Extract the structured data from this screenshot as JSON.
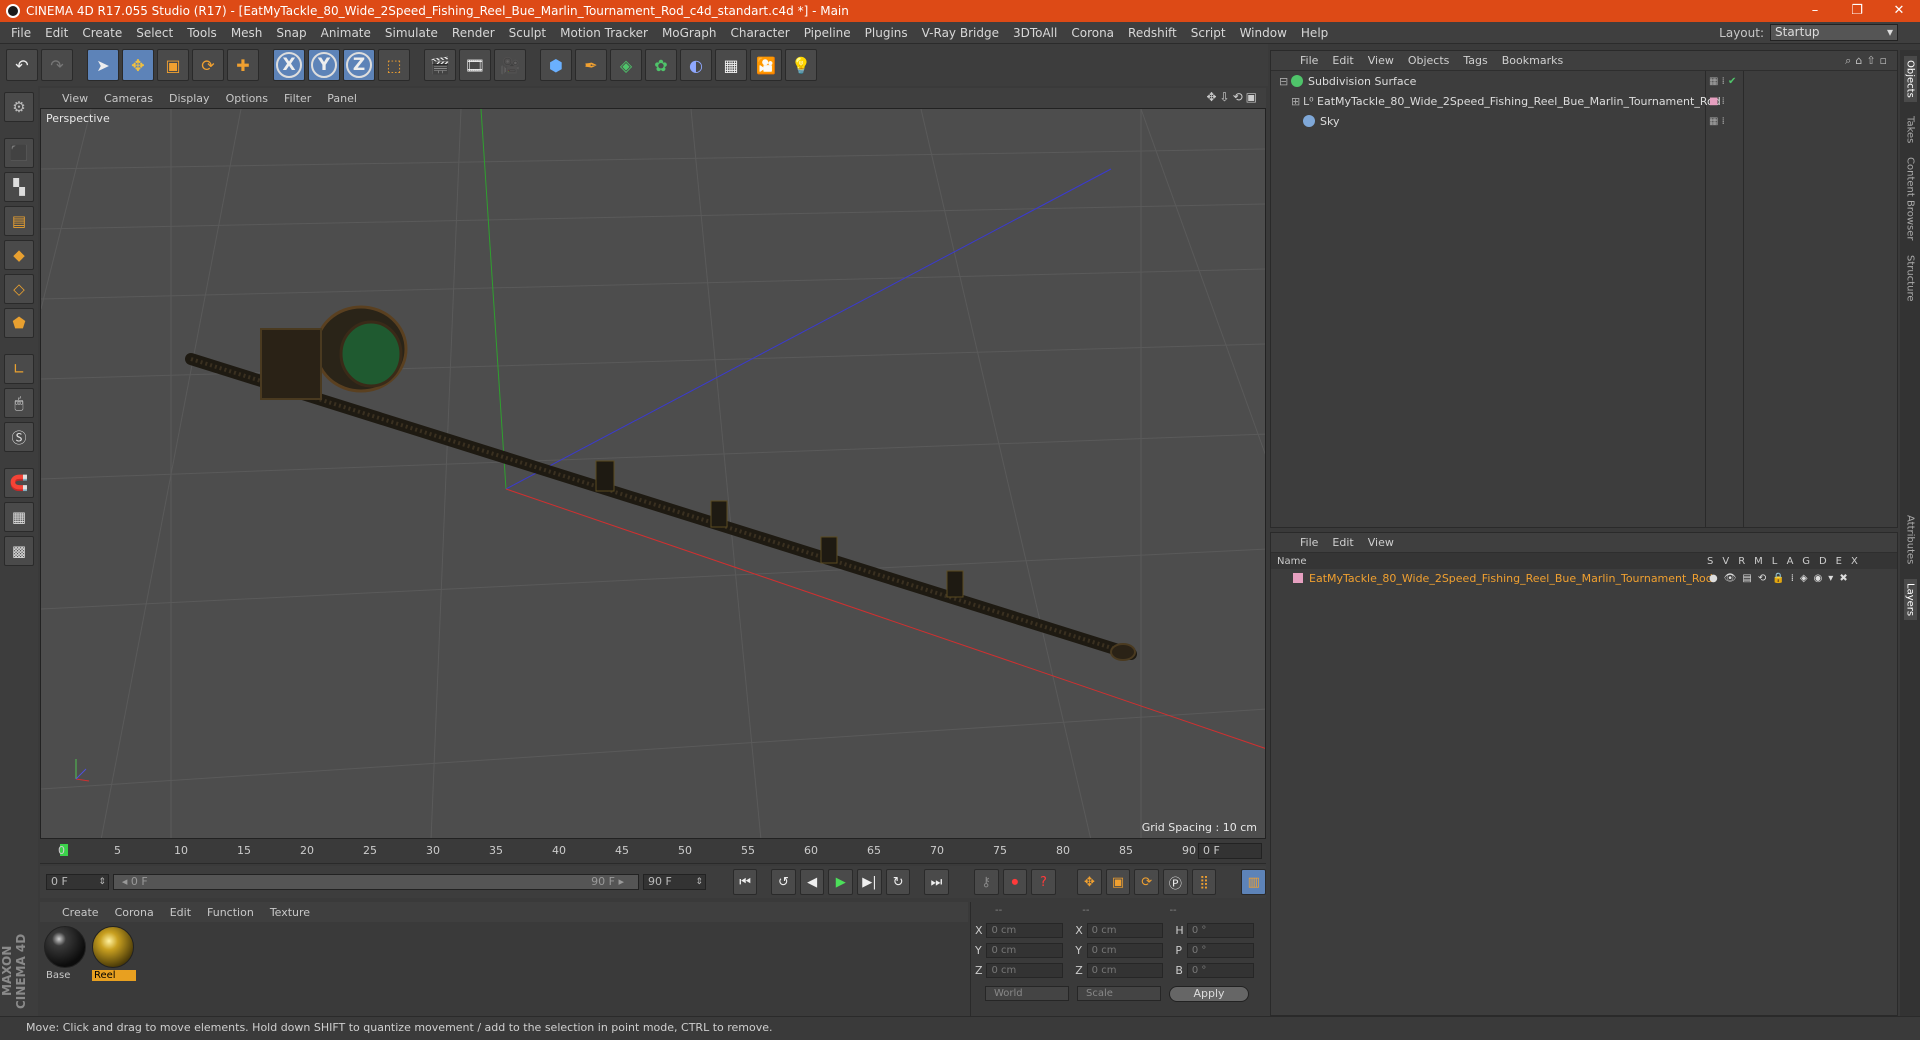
{
  "window": {
    "title": "CINEMA 4D R17.055 Studio (R17) - [EatMyTackle_80_Wide_2Speed_Fishing_Reel_Bue_Marlin_Tournament_Rod_c4d_standart.c4d *] - Main",
    "minimize": "–",
    "maximize": "❐",
    "close": "✕"
  },
  "menubar": [
    "File",
    "Edit",
    "Create",
    "Select",
    "Tools",
    "Mesh",
    "Snap",
    "Animate",
    "Simulate",
    "Render",
    "Sculpt",
    "Motion Tracker",
    "MoGraph",
    "Character",
    "Pipeline",
    "Plugins",
    "V-Ray Bridge",
    "3DToAll",
    "Corona",
    "Redshift",
    "Script",
    "Window",
    "Help"
  ],
  "layout": {
    "label": "Layout:",
    "value": "Startup"
  },
  "toolbar": {
    "x": "X",
    "y": "Y",
    "z": "Z"
  },
  "viewport": {
    "menu": [
      "View",
      "Cameras",
      "Display",
      "Options",
      "Filter",
      "Panel"
    ],
    "icons": "✥⇩⟲▣",
    "label": "Perspective",
    "grid_spacing": "Grid Spacing : 10 cm"
  },
  "timeline": {
    "ticks": [
      "0",
      "5",
      "10",
      "15",
      "20",
      "25",
      "30",
      "35",
      "40",
      "45",
      "50",
      "55",
      "60",
      "65",
      "70",
      "75",
      "80",
      "85",
      "90"
    ],
    "frame": "0 F",
    "start": "0 F",
    "range_left": "◂ 0 F",
    "range_right": "90 F ▸",
    "end": "90 F"
  },
  "materials": {
    "menu": [
      "Create",
      "Corona",
      "Edit",
      "Function",
      "Texture"
    ],
    "items": [
      {
        "name": "Base",
        "selected": false
      },
      {
        "name": "Reel",
        "selected": true
      }
    ]
  },
  "coords": {
    "headers": [
      "--",
      "--",
      "--"
    ],
    "rows": [
      {
        "a": "X",
        "av": "0 cm",
        "b": "X",
        "bv": "0 cm",
        "c": "H",
        "cv": "0 °"
      },
      {
        "a": "Y",
        "av": "0 cm",
        "b": "Y",
        "bv": "0 cm",
        "c": "P",
        "cv": "0 °"
      },
      {
        "a": "Z",
        "av": "0 cm",
        "b": "Z",
        "bv": "0 cm",
        "c": "B",
        "cv": "0 °"
      }
    ],
    "mode1": "World",
    "mode2": "Scale",
    "apply": "Apply"
  },
  "objects": {
    "menu": [
      "File",
      "Edit",
      "View",
      "Objects",
      "Tags",
      "Bookmarks"
    ],
    "items": [
      {
        "name": "Subdivision Surface",
        "color": "#4fc46a"
      },
      {
        "name": "EatMyTackle_80_Wide_2Speed_Fishing_Reel_Bue_Marlin_Tournament_Rod",
        "color": "#9ab0d0"
      },
      {
        "name": "Sky",
        "color": "#7fa8d8"
      }
    ]
  },
  "layers": {
    "menu": [
      "File",
      "Edit",
      "View"
    ],
    "col_name": "Name",
    "cols": "SVRMLAGDEX",
    "row": "EatMyTackle_80_Wide_2Speed_Fishing_Reel_Bue_Marlin_Tournament_Rod"
  },
  "right_tabs": [
    "Objects",
    "Takes",
    "Content Browser",
    "Structure",
    "Attributes",
    "Layers"
  ],
  "maxon": "MAXON CINEMA 4D",
  "status": "Move: Click and drag to move elements. Hold down SHIFT to quantize movement / add to the selection in point mode, CTRL to remove."
}
